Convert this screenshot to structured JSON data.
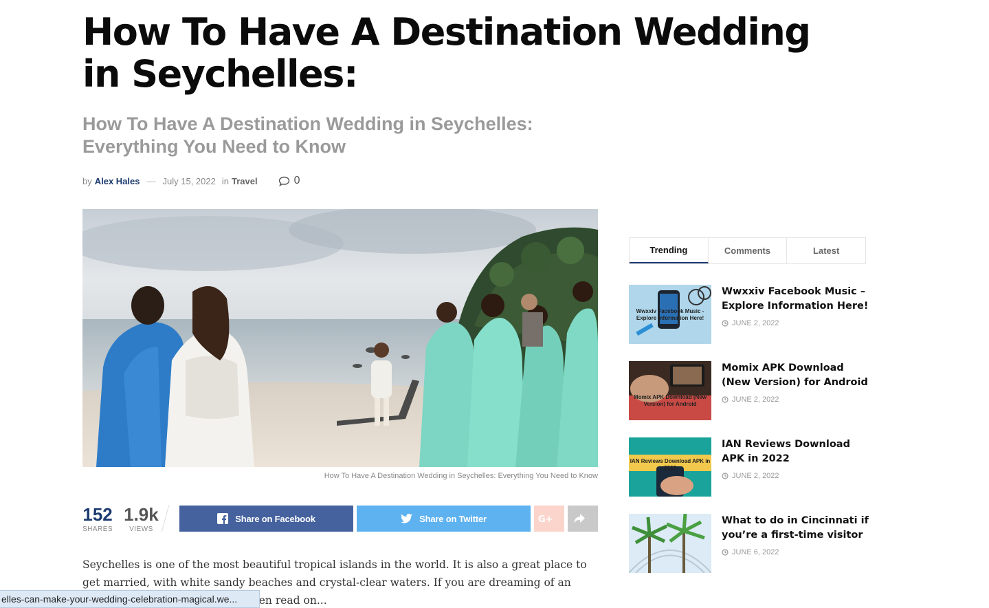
{
  "article": {
    "title": "How To Have A Destination Wedding in Seychelles:",
    "subtitle": "How To Have A Destination Wedding in Seychelles: Everything You Need to Know",
    "meta": {
      "by_label": "by",
      "author": "Alex Hales",
      "separator": "—",
      "date": "July 15, 2022",
      "in_label": "in",
      "category": "Travel",
      "comment_count": "0"
    },
    "image_caption": "How To Have A Destination Wedding in Seychelles: Everything You Need to Know",
    "stats": {
      "shares_value": "152",
      "shares_label": "SHARES",
      "views_value": "1.9k",
      "views_label": "VIEWS"
    },
    "share": {
      "facebook_label": "Share on Facebook",
      "twitter_label": "Share on Twitter"
    },
    "body_text": "Seychelles is one of the most beautiful tropical islands in the world. It is also a great place to get married, with white sandy beaches and crystal-clear waters. If you are dreaming of an exotic location to tie the knot, then read on..."
  },
  "status_bar": {
    "url": "elles-can-make-your-wedding-celebration-magical.we..."
  },
  "sidebar": {
    "tabs": [
      {
        "label": "Trending",
        "active": true
      },
      {
        "label": "Comments",
        "active": false
      },
      {
        "label": "Latest",
        "active": false
      }
    ],
    "posts": [
      {
        "title": "Wwxxiv Facebook Music – Explore Information Here!",
        "date": "JUNE 2, 2022",
        "thumb_text": "Wwxxiv Facebook Music - Explore Information Here!"
      },
      {
        "title": "Momix APK Download (New Version) for Android",
        "date": "JUNE 2, 2022",
        "thumb_text": "Momix APK Download (New Version) for Android"
      },
      {
        "title": "IAN Reviews Download APK in 2022",
        "date": "JUNE 2, 2022",
        "thumb_text": "IAN Reviews Download APK in 2022"
      },
      {
        "title": "What to do in Cincinnati if you’re a first-time visitor",
        "date": "JUNE 6, 2022",
        "thumb_text": ""
      }
    ]
  },
  "colors": {
    "brand_navy": "#1d3b70",
    "facebook": "#45629f",
    "twitter": "#5eb2ef",
    "google_plus": "#fbd5cb",
    "share_more": "#c9c9c9"
  }
}
